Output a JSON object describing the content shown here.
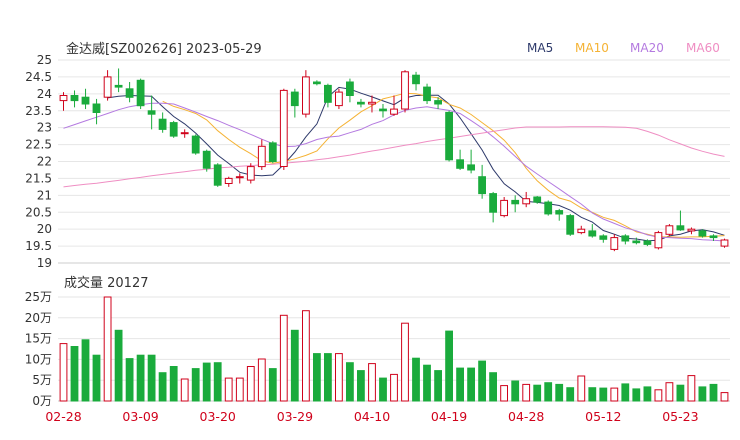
{
  "chart_data": [
    {
      "type": "candlestick",
      "title": "金达威[SZ002626] 2023-05-29",
      "legend": [
        {
          "name": "MA5",
          "color": "#2e3a6b"
        },
        {
          "name": "MA10",
          "color": "#f5b335"
        },
        {
          "name": "MA20",
          "color": "#b47ae0"
        },
        {
          "name": "MA60",
          "color": "#ef8ec3"
        }
      ],
      "legend_position": "top-right",
      "ylim": [
        19,
        25
      ],
      "yticks": [
        "25",
        "24.5",
        "24",
        "23.5",
        "23",
        "22.5",
        "22",
        "21.5",
        "21",
        "20.5",
        "20",
        "19.5",
        "19"
      ],
      "grid": true,
      "x": [
        "02-28",
        "03-01",
        "03-02",
        "03-03",
        "03-06",
        "03-07",
        "03-08",
        "03-09",
        "03-10",
        "03-13",
        "03-14",
        "03-15",
        "03-16",
        "03-17",
        "03-20",
        "03-21",
        "03-22",
        "03-23",
        "03-24",
        "03-27",
        "03-28",
        "03-29",
        "03-30",
        "03-31",
        "04-03",
        "04-04",
        "04-06",
        "04-07",
        "04-10",
        "04-11",
        "04-12",
        "04-13",
        "04-14",
        "04-17",
        "04-18",
        "04-19",
        "04-20",
        "04-21",
        "04-24",
        "04-25",
        "04-26",
        "04-27",
        "04-28",
        "05-04",
        "05-05",
        "05-08",
        "05-09",
        "05-10",
        "05-11",
        "05-12",
        "05-15",
        "05-16",
        "05-17",
        "05-18",
        "05-19",
        "05-22",
        "05-23",
        "05-24",
        "05-25",
        "05-26",
        "05-29"
      ],
      "xticks": [
        "02-28",
        "03-09",
        "03-20",
        "03-29",
        "04-10",
        "04-19",
        "04-28",
        "05-12",
        "05-23"
      ],
      "ohlc": [
        [
          23.8,
          24.05,
          23.5,
          23.95
        ],
        [
          23.95,
          24.1,
          23.6,
          23.8
        ],
        [
          23.9,
          24.15,
          23.55,
          23.7
        ],
        [
          23.7,
          23.85,
          23.1,
          23.45
        ],
        [
          23.9,
          24.7,
          23.8,
          24.5
        ],
        [
          24.25,
          24.75,
          24.05,
          24.2
        ],
        [
          24.15,
          24.35,
          23.75,
          23.9
        ],
        [
          24.4,
          24.45,
          23.55,
          23.65
        ],
        [
          23.5,
          23.95,
          22.95,
          23.4
        ],
        [
          23.25,
          23.45,
          22.85,
          22.95
        ],
        [
          23.15,
          23.2,
          22.7,
          22.75
        ],
        [
          22.85,
          22.95,
          22.7,
          22.85
        ],
        [
          22.75,
          22.8,
          22.2,
          22.25
        ],
        [
          22.3,
          22.35,
          21.7,
          21.8
        ],
        [
          21.9,
          21.95,
          21.25,
          21.3
        ],
        [
          21.35,
          21.55,
          21.25,
          21.5
        ],
        [
          21.55,
          21.65,
          21.35,
          21.55
        ],
        [
          21.45,
          21.95,
          21.35,
          21.85
        ],
        [
          21.85,
          22.65,
          21.75,
          22.45
        ],
        [
          22.55,
          22.6,
          21.95,
          22.0
        ],
        [
          21.85,
          24.15,
          21.75,
          24.1
        ],
        [
          24.05,
          24.15,
          23.3,
          23.65
        ],
        [
          23.4,
          24.7,
          23.3,
          24.5
        ],
        [
          24.35,
          24.4,
          24.25,
          24.3
        ],
        [
          24.25,
          24.3,
          23.6,
          23.75
        ],
        [
          23.65,
          24.15,
          23.55,
          24.05
        ],
        [
          24.35,
          24.45,
          23.75,
          23.95
        ],
        [
          23.75,
          23.85,
          23.6,
          23.7
        ],
        [
          23.7,
          23.95,
          23.45,
          23.75
        ],
        [
          23.55,
          23.7,
          23.3,
          23.5
        ],
        [
          23.4,
          23.95,
          23.35,
          23.55
        ],
        [
          23.55,
          24.7,
          23.45,
          24.65
        ],
        [
          24.55,
          24.65,
          24.1,
          24.3
        ],
        [
          24.2,
          24.3,
          23.7,
          23.8
        ],
        [
          23.8,
          23.9,
          23.55,
          23.7
        ],
        [
          23.45,
          23.5,
          22.0,
          22.05
        ],
        [
          22.05,
          22.35,
          21.75,
          21.8
        ],
        [
          21.9,
          22.35,
          21.65,
          21.75
        ],
        [
          21.55,
          21.9,
          20.9,
          21.05
        ],
        [
          21.05,
          21.1,
          20.2,
          20.5
        ],
        [
          20.4,
          20.95,
          20.35,
          20.85
        ],
        [
          20.85,
          21.0,
          20.5,
          20.75
        ],
        [
          20.75,
          21.1,
          20.65,
          20.9
        ],
        [
          20.95,
          20.98,
          20.75,
          20.8
        ],
        [
          20.8,
          20.85,
          20.4,
          20.45
        ],
        [
          20.55,
          20.6,
          20.25,
          20.45
        ],
        [
          20.4,
          20.45,
          19.8,
          19.85
        ],
        [
          19.9,
          20.1,
          19.85,
          20.0
        ],
        [
          19.95,
          20.15,
          19.75,
          19.8
        ],
        [
          19.8,
          19.85,
          19.6,
          19.7
        ],
        [
          19.4,
          19.85,
          19.35,
          19.75
        ],
        [
          19.8,
          19.85,
          19.55,
          19.65
        ],
        [
          19.65,
          19.75,
          19.55,
          19.6
        ],
        [
          19.65,
          19.7,
          19.5,
          19.55
        ],
        [
          19.45,
          19.95,
          19.4,
          19.9
        ],
        [
          19.85,
          20.15,
          19.8,
          20.1
        ],
        [
          20.1,
          20.55,
          19.95,
          19.98
        ],
        [
          19.95,
          20.05,
          19.85,
          20.0
        ],
        [
          19.95,
          20.0,
          19.75,
          19.8
        ],
        [
          19.8,
          19.85,
          19.65,
          19.75
        ],
        [
          19.5,
          19.72,
          19.45,
          19.68
        ]
      ],
      "ma": {
        "MA5": [
          null,
          null,
          null,
          null,
          23.88,
          23.93,
          23.95,
          23.94,
          23.93,
          23.62,
          23.33,
          23.11,
          22.84,
          22.52,
          22.19,
          21.94,
          21.68,
          21.6,
          21.58,
          21.6,
          21.91,
          22.28,
          22.73,
          23.11,
          23.91,
          24.19,
          24.14,
          24.02,
          23.91,
          23.79,
          23.68,
          23.88,
          23.95,
          23.96,
          23.96,
          23.7,
          23.29,
          22.82,
          22.34,
          21.77,
          21.34,
          21.1,
          20.82,
          20.79,
          20.75,
          20.7,
          20.56,
          20.35,
          20.21,
          19.96,
          19.85,
          19.73,
          19.71,
          19.66,
          19.67,
          19.8,
          19.85,
          19.95,
          19.98,
          19.92,
          19.82
        ],
        "MA10": [
          null,
          null,
          null,
          null,
          null,
          null,
          null,
          null,
          null,
          23.78,
          23.63,
          23.53,
          23.42,
          23.23,
          22.91,
          22.65,
          22.42,
          22.23,
          22.02,
          21.95,
          22.0,
          22.08,
          22.18,
          22.31,
          22.67,
          22.99,
          23.22,
          23.47,
          23.65,
          23.85,
          23.93,
          24.02,
          24.0,
          23.93,
          23.88,
          23.69,
          23.58,
          23.39,
          23.15,
          22.91,
          22.63,
          22.26,
          21.8,
          21.43,
          21.15,
          20.92,
          20.83,
          20.63,
          20.5,
          20.35,
          20.26,
          20.1,
          19.92,
          19.85,
          19.77,
          19.77,
          19.76,
          19.77,
          19.77,
          19.79,
          19.81
        ],
        "MA20": [
          22.98,
          23.09,
          23.2,
          23.31,
          23.42,
          23.53,
          23.62,
          23.68,
          23.72,
          23.72,
          23.7,
          23.58,
          23.46,
          23.33,
          23.21,
          23.07,
          22.94,
          22.8,
          22.66,
          22.53,
          22.44,
          22.45,
          22.53,
          22.65,
          22.72,
          22.75,
          22.85,
          22.95,
          23.1,
          23.21,
          23.38,
          23.51,
          23.58,
          23.62,
          23.56,
          23.51,
          23.42,
          23.21,
          22.99,
          22.73,
          22.45,
          22.15,
          21.86,
          21.63,
          21.41,
          21.19,
          20.96,
          20.74,
          20.48,
          20.3,
          20.17,
          20.04,
          19.95,
          19.83,
          19.76,
          19.75,
          19.73,
          19.72,
          19.69,
          19.67,
          19.65
        ],
        "MA60": [
          21.25,
          21.29,
          21.33,
          21.36,
          21.4,
          21.44,
          21.49,
          21.53,
          21.58,
          21.62,
          21.66,
          21.7,
          21.74,
          21.77,
          21.81,
          21.83,
          21.86,
          21.88,
          21.9,
          21.92,
          21.95,
          21.98,
          22.01,
          22.05,
          22.09,
          22.14,
          22.19,
          22.25,
          22.31,
          22.36,
          22.42,
          22.48,
          22.53,
          22.59,
          22.64,
          22.69,
          22.74,
          22.79,
          22.84,
          22.89,
          22.94,
          22.99,
          23.02,
          23.02,
          23.02,
          23.02,
          23.03,
          23.03,
          23.03,
          23.03,
          23.02,
          23.01,
          22.98,
          22.89,
          22.78,
          22.64,
          22.52,
          22.4,
          22.3,
          22.22,
          22.15
        ]
      }
    },
    {
      "type": "bar",
      "title": "成交量 20127",
      "ylim": [
        0,
        250000
      ],
      "yticks": [
        "25万",
        "20万",
        "15万",
        "10万",
        "5万",
        "0万"
      ],
      "grid": true,
      "values": [
        138000,
        131000,
        147000,
        110000,
        250000,
        170000,
        102000,
        110000,
        110000,
        68000,
        83000,
        53000,
        78000,
        91000,
        92000,
        55000,
        55000,
        83000,
        101000,
        78000,
        206000,
        170000,
        217000,
        114000,
        114000,
        114000,
        92000,
        73000,
        90000,
        55000,
        64000,
        187000,
        103000,
        86000,
        73000,
        168000,
        79000,
        79000,
        96000,
        68000,
        37000,
        48000,
        40000,
        38000,
        44000,
        40000,
        32000,
        60000,
        32000,
        31000,
        31000,
        41000,
        29000,
        34000,
        27000,
        44000,
        38000,
        61000,
        34000,
        40000,
        20127
      ]
    }
  ]
}
